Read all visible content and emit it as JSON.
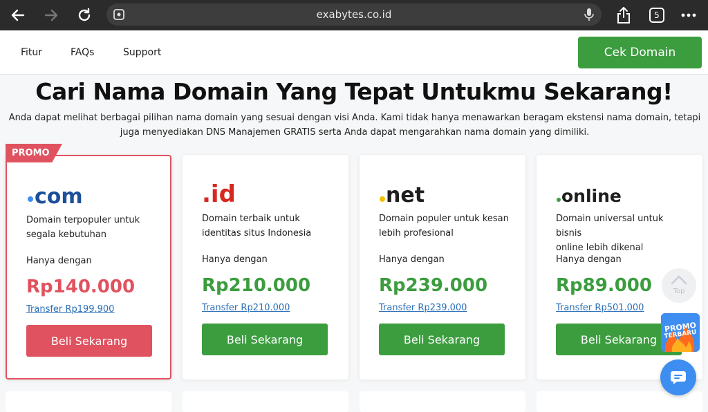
{
  "browser": {
    "url": "exabytes.co.id",
    "tab_count": "5",
    "icons": [
      "back-arrow-icon",
      "forward-arrow-icon",
      "reload-icon",
      "site-settings-icon",
      "microphone-icon",
      "share-icon",
      "tabs-icon",
      "more-icon"
    ]
  },
  "nav": {
    "links": [
      "Fitur",
      "FAQs",
      "Support"
    ],
    "cta_label": "Cek Domain"
  },
  "hero": {
    "title": "Cari Nama Domain Yang Tepat Untukmu Sekarang!",
    "description": "Anda dapat melihat berbagai pilihan nama domain yang sesuai dengan visi Anda. Kami tidak hanya menawarkan beragam ekstensi nama domain, tetapi juga menyediakan DNS Manajemen GRATIS serta Anda dapat mengarahkan nama domain yang dimiliki."
  },
  "promo_tag": "PROMO",
  "cards": [
    {
      "tld": ".com",
      "desc_line1": "Domain terpopuler untuk",
      "desc_line2": "segala kebutuhan",
      "only_label": "Hanya dengan",
      "price": "Rp140.000",
      "transfer": "Transfer Rp199.900",
      "button": "Beli Sekarang",
      "price_color": "#e0525f",
      "button_color": "#e0525f"
    },
    {
      "tld": ".id",
      "desc_line1": "Domain terbaik untuk",
      "desc_line2": "identitas situs Indonesia",
      "only_label": "Hanya dengan",
      "price": "Rp210.000",
      "transfer": "Transfer Rp210.000",
      "button": "Beli Sekarang",
      "price_color": "#3c9d3f",
      "button_color": "#3c9d3f"
    },
    {
      "tld": ".net",
      "desc_line1": "Domain populer untuk kesan",
      "desc_line2": "lebih profesional",
      "only_label": "Hanya dengan",
      "price": "Rp239.000",
      "transfer": "Transfer Rp239.000",
      "button": "Beli Sekarang",
      "price_color": "#3c9d3f",
      "button_color": "#3c9d3f"
    },
    {
      "tld": ".online",
      "desc_line1": "Domain universal untuk bisnis",
      "desc_line2": "online lebih dikenal",
      "only_label": "Hanya dengan",
      "price": "Rp89.000",
      "transfer": "Transfer Rp501.000",
      "button": "Beli Sekarang",
      "price_color": "#3c9d3f",
      "button_color": "#3c9d3f"
    }
  ],
  "floating": {
    "top_label": "Top",
    "promo_line1": "PROMO",
    "promo_line2": "TERBARU"
  },
  "colors": {
    "brand_green": "#3c9d3f",
    "promo_red": "#e0525f",
    "link_blue": "#2a6fb7"
  }
}
